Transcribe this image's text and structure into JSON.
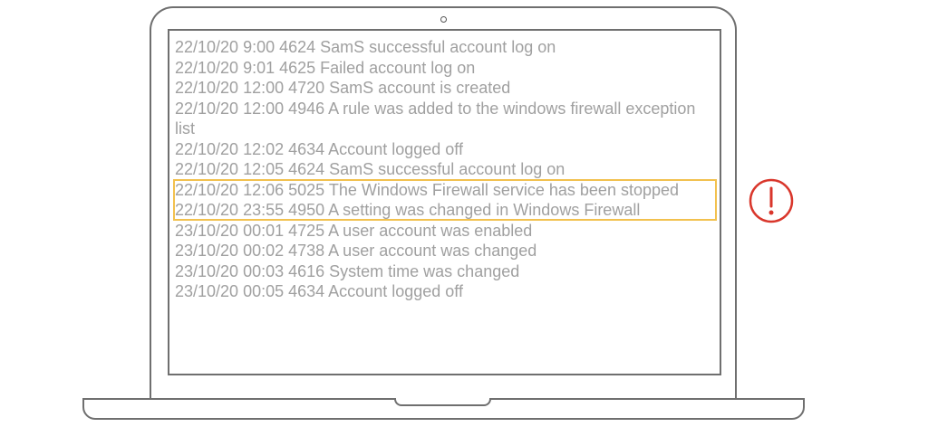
{
  "log_entries": [
    "22/10/20 9:00 4624 SamS successful account log on",
    "22/10/20 9:01 4625 Failed account log on",
    "22/10/20 12:00 4720 SamS account is created",
    "22/10/20 12:00 4946 A rule was added to the windows firewall exception list",
    "22/10/20 12:02 4634 Account logged off",
    "22/10/20 12:05 4624 SamS successful account log on",
    "22/10/20 12:06 5025 The Windows Firewall service has been stopped",
    "22/10/20 23:55 4950 A setting was changed in Windows Firewall",
    "23/10/20 00:01 4725 A user account was enabled",
    "23/10/20 00:02 4738 A user account was changed",
    "23/10/20 00:03 4616 System time was changed",
    "23/10/20 00:05 4634 Account logged off"
  ],
  "highlighted_entry_index": 6,
  "alert_icon": "exclamation-circle-icon",
  "colors": {
    "log_text": "#a0a0a0",
    "highlight": "#f2c14e",
    "alert": "#d9362b",
    "device_outline": "#6f6f6f"
  }
}
